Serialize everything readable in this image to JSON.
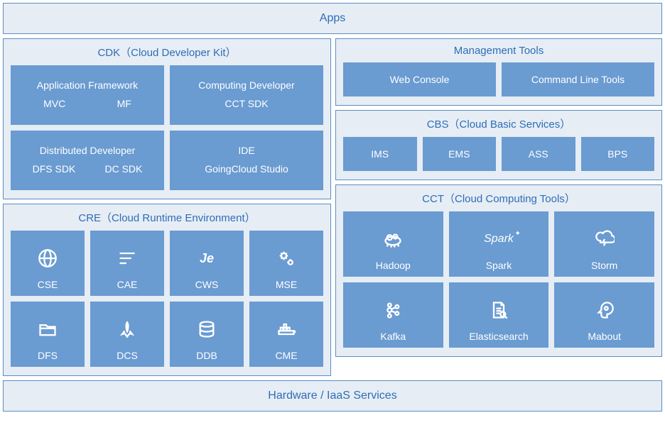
{
  "top_banner": "Apps",
  "bottom_banner": "Hardware / IaaS Services",
  "cdk": {
    "title": "CDK（Cloud Developer Kit）",
    "boxes": [
      {
        "title": "Application Framework",
        "items": [
          "MVC",
          "MF"
        ]
      },
      {
        "title": "Computing Developer",
        "items": [
          "CCT SDK"
        ]
      },
      {
        "title": "Distributed Developer",
        "items": [
          "DFS SDK",
          "DC SDK"
        ]
      },
      {
        "title": "IDE",
        "items": [
          "GoingCloud Studio"
        ]
      }
    ]
  },
  "mgmt": {
    "title": "Management Tools",
    "items": [
      "Web Console",
      "Command Line Tools"
    ]
  },
  "cbs": {
    "title": "CBS（Cloud Basic Services）",
    "items": [
      "IMS",
      "EMS",
      "ASS",
      "BPS"
    ]
  },
  "cre": {
    "title": "CRE（Cloud Runtime Environment）",
    "items": [
      "CSE",
      "CAE",
      "CWS",
      "MSE",
      "DFS",
      "DCS",
      "DDB",
      "CME"
    ]
  },
  "cct": {
    "title": "CCT（Cloud Computing Tools）",
    "items": [
      "Hadoop",
      "Spark",
      "Storm",
      "Kafka",
      "Elasticsearch",
      "Mabout"
    ]
  }
}
